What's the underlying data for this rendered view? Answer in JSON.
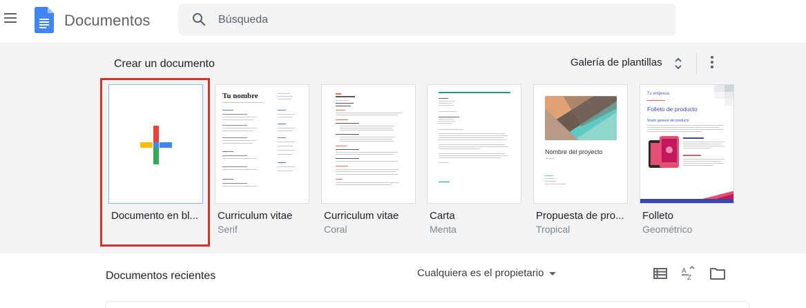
{
  "header": {
    "app_title": "Documentos",
    "search_placeholder": "Búsqueda",
    "brand_color": "#4285f4"
  },
  "gallery": {
    "title": "Crear un documento",
    "gallery_button": "Galería de plantillas",
    "templates": [
      {
        "name": "Documento en bl...",
        "sub": "",
        "selected": true
      },
      {
        "name": "Curriculum vitae",
        "sub": "Serif"
      },
      {
        "name": "Curriculum vitae",
        "sub": "Coral"
      },
      {
        "name": "Carta",
        "sub": "Menta"
      },
      {
        "name": "Propuesta de pro...",
        "sub": "Tropical"
      },
      {
        "name": "Folleto",
        "sub": "Geométrico"
      }
    ],
    "thumb_text": {
      "serif_heading": "Tu nombre",
      "tropical_title": "Nombre del proyecto",
      "geo_company": "Tu empresa",
      "geo_title": "Folleto de producto",
      "geo_subtitle": "Visión general del producto"
    }
  },
  "recent": {
    "title": "Documentos recientes",
    "owner_filter": "Cualquiera es el propietario"
  },
  "icons": [
    "menu-icon",
    "docs-logo-icon",
    "search-icon",
    "unfold-icon",
    "more-vert-icon",
    "plus-icon",
    "list-view-icon",
    "sort-az-icon",
    "folder-icon"
  ],
  "colors": {
    "selection": "#d93025",
    "gallery_bg": "#f1f3f4"
  }
}
